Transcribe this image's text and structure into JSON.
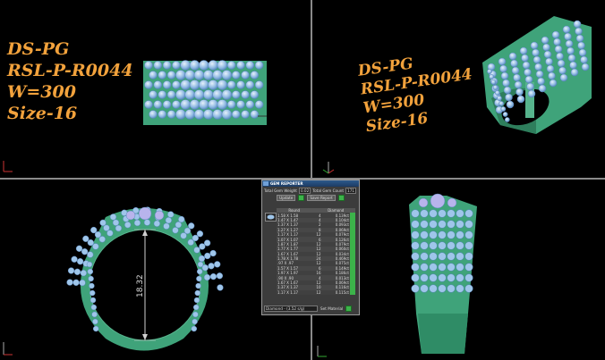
{
  "labels": {
    "top_left": [
      "DS-PG",
      "RSL-P-R0044",
      "W=300",
      "Size-16"
    ],
    "top_right": [
      "DS-PG",
      "RSL-P-R0044",
      "W=300",
      "Size-16"
    ]
  },
  "dimension": "18.32",
  "gem_reporter": {
    "title": "GEM REPORTER",
    "total_weight_label": "Total Gem Weight",
    "total_weight_value": "0.02",
    "total_count_label": "Total Gem Count",
    "total_count_value": "171",
    "update_label": "Update",
    "save_report_label": "Save Report",
    "columns": [
      "Round",
      "",
      "Diamond"
    ],
    "rows": [
      [
        "1.58 X 1.58",
        "4",
        "0.139ct"
      ],
      [
        "1.47 X 1.47",
        "4",
        "0.104ct"
      ],
      [
        "1.37 X 1.37",
        "2",
        "0.093ct"
      ],
      [
        "1.27 X 1.27",
        "8",
        "0.069ct"
      ],
      [
        "1.17 X 1.17",
        "12",
        "0.079ct"
      ],
      [
        "1.07 X 1.07",
        "6",
        "0.126ct"
      ],
      [
        "1.87 X 1.87",
        "12",
        "0.079ct"
      ],
      [
        "1.77 X 1.77",
        "12",
        "0.060ct"
      ],
      [
        "1.67 X 1.67",
        "12",
        "0.034ct"
      ],
      [
        "1.78 X 1.78",
        "24",
        "0.469ct"
      ],
      [
        ".97 X .97",
        "12",
        "0.075ct"
      ],
      [
        "1.57 X 1.57",
        "6",
        "0.149ct"
      ],
      [
        "1.97 X 1.97",
        "16",
        "0.186ct"
      ],
      [
        ".90 X .90",
        "4",
        "0.013ct"
      ],
      [
        "1.67 X 1.67",
        "12",
        "0.069ct"
      ],
      [
        "1.37 X 1.37",
        "10",
        "0.116ct"
      ],
      [
        "1.17 X 1.17",
        "12",
        "0.115ct"
      ]
    ],
    "material_value": "Diamond - (3.52 s/g)",
    "set_material_label": "Set Material"
  },
  "colors": {
    "ring_metal": "#3fa37a",
    "gem": "#9fc6ea",
    "label_orange": "#f2a23c",
    "background": "#000000"
  }
}
